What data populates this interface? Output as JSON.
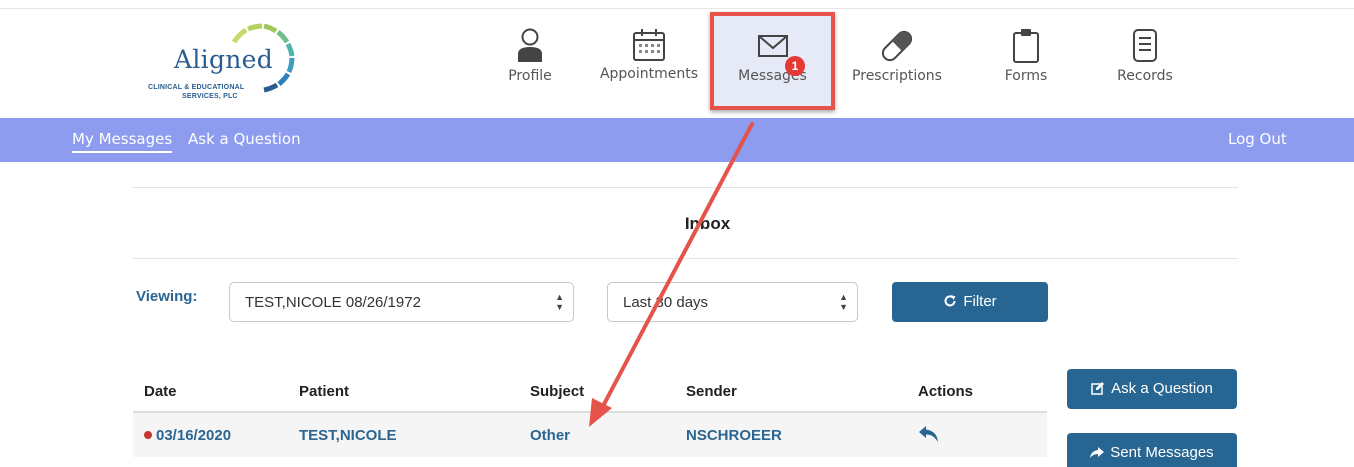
{
  "logo": {
    "word": "Aligned",
    "sub_line1": "CLINICAL & EDUCATIONAL",
    "sub_line2": "SERVICES, PLC"
  },
  "nav": {
    "profile": "Profile",
    "appointments": "Appointments",
    "messages": "Messages",
    "messages_badge": "1",
    "prescriptions": "Prescriptions",
    "forms": "Forms",
    "records": "Records"
  },
  "subnav": {
    "my_messages": "My Messages",
    "ask_question": "Ask a Question",
    "logout": "Log Out"
  },
  "inbox": {
    "title": "Inbox",
    "viewing_label": "Viewing:",
    "patient_select": "TEST,NICOLE 08/26/1972",
    "range_select": "Last 30 days",
    "filter_label": "Filter"
  },
  "table": {
    "headers": [
      "Date",
      "Patient",
      "Subject",
      "Sender",
      "Actions"
    ],
    "rows": [
      {
        "date": "03/16/2020",
        "patient": "TEST,NICOLE",
        "subject": "Other",
        "sender": "NSCHROEER"
      }
    ]
  },
  "actions": {
    "ask_question_btn": "Ask a Question",
    "sent_messages_btn": "Sent Messages"
  },
  "colors": {
    "accent": "#276592",
    "subbar": "#8e9cf0",
    "highlight_red": "#e5534b",
    "unread_dot": "#c0392b"
  }
}
